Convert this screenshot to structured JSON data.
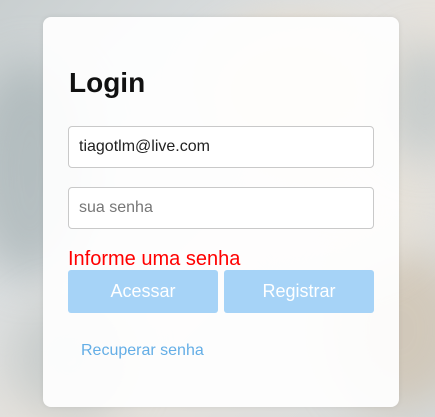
{
  "login": {
    "title": "Login",
    "email_value": "tiagotlm@live.com",
    "password_placeholder": "sua senha",
    "error_message": "Informe uma senha",
    "access_button": "Acessar",
    "register_button": "Registrar",
    "recover_link": "Recuperar senha"
  },
  "colors": {
    "error": "#ff0000",
    "button_bg": "#a6d3f7",
    "link": "#64aee6"
  }
}
